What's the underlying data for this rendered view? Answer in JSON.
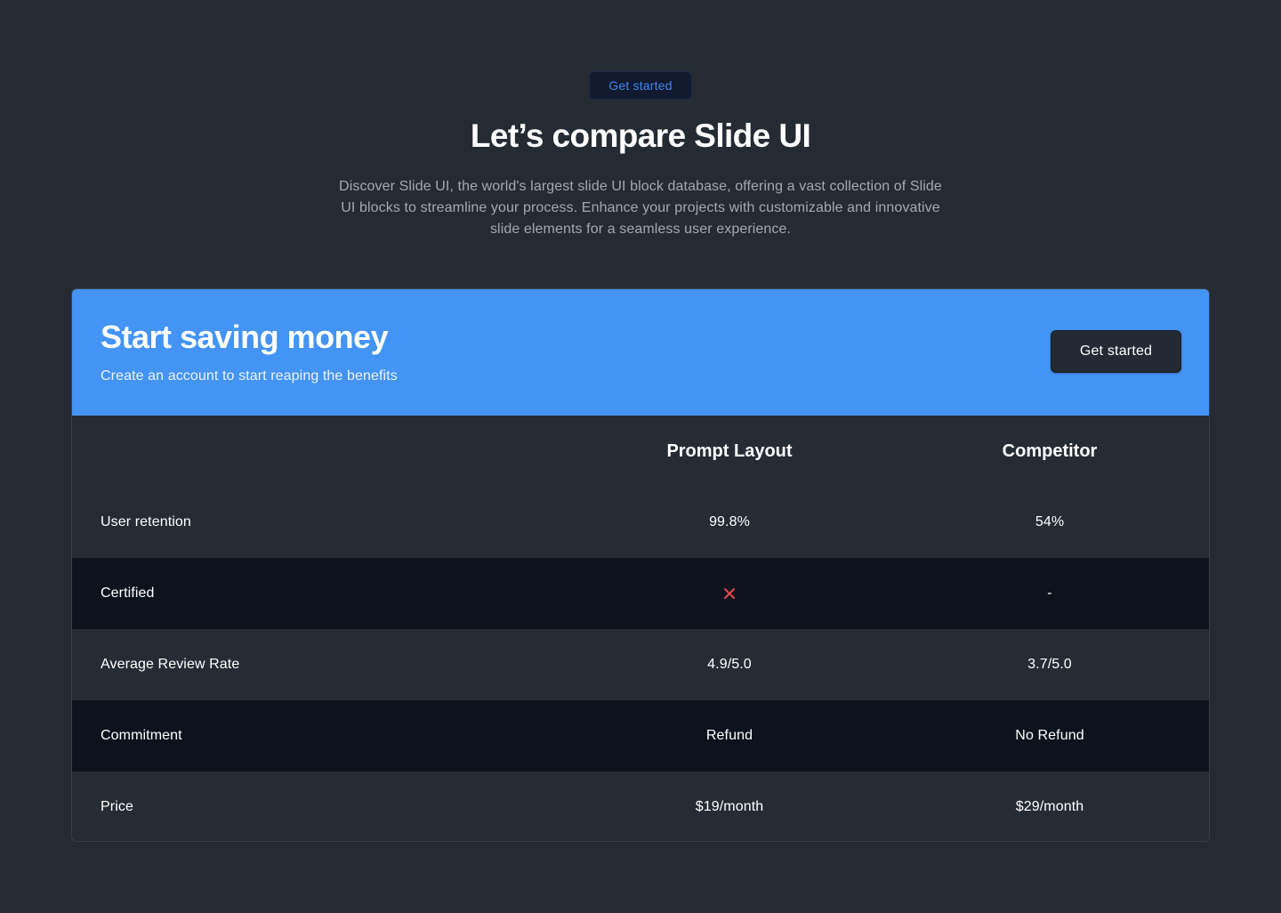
{
  "hero": {
    "badge_label": "Get started",
    "title": "Let’s compare Slide UI",
    "description": "Discover Slide UI, the world's largest slide UI block database, offering a vast collection of Slide UI blocks to streamline your process. Enhance your projects with customizable and innovative slide elements for a seamless user experience."
  },
  "banner": {
    "title": "Start saving money",
    "subtitle": "Create an account to start reaping the benefits",
    "button_label": "Get started"
  },
  "table": {
    "columns": [
      "Prompt Layout",
      "Competitor"
    ],
    "rows": [
      {
        "label": "User retention",
        "values": [
          "99.8%",
          "54%"
        ]
      },
      {
        "label": "Certified",
        "values": [
          "",
          "-"
        ],
        "icon": "x-icon"
      },
      {
        "label": "Average Review Rate",
        "values": [
          "4.9/5.0",
          "3.7/5.0"
        ]
      },
      {
        "label": "Commitment",
        "values": [
          "Refund",
          "No Refund"
        ]
      },
      {
        "label": "Price",
        "values": [
          "$19/month",
          "$29/month"
        ]
      }
    ]
  },
  "colors": {
    "background": "#252b33",
    "accent": "#4394f4",
    "badge_text": "#3f86ef",
    "x_icon": "#e5484d",
    "row_dark": "#0d131d"
  }
}
